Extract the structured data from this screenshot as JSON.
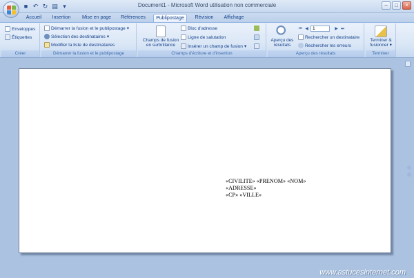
{
  "window": {
    "title": "Document1 - Microsoft Word utilisation non commerciale",
    "controls": {
      "minimize": "–",
      "maximize": "□",
      "close": "×"
    }
  },
  "quick_access": {
    "icons": [
      "save-icon",
      "undo-icon",
      "redo-icon",
      "print-preview-icon",
      "customize-icon"
    ],
    "glyphs": {
      "save": "■",
      "undo": "↶",
      "redo": "↻",
      "print": "▤",
      "more": "▾"
    }
  },
  "tabs": [
    {
      "label": "Accueil",
      "active": false
    },
    {
      "label": "Insertion",
      "active": false
    },
    {
      "label": "Mise en page",
      "active": false
    },
    {
      "label": "Références",
      "active": false
    },
    {
      "label": "Publipostage",
      "active": true
    },
    {
      "label": "Révision",
      "active": false
    },
    {
      "label": "Affichage",
      "active": false
    }
  ],
  "ribbon": {
    "creer": {
      "label": "Créer",
      "envelopes": "Enveloppes",
      "labels": "Étiquettes"
    },
    "demarrer": {
      "label": "Démarrer la fusion et le publipostage",
      "start_merge": "Démarrer la fusion et le publipostage",
      "select_recipients": "Sélection des destinataires",
      "edit_list": "Modifier la liste de destinataires"
    },
    "champs": {
      "label": "Champs d'écriture et d'insertion",
      "highlight_line1": "Champs de fusion",
      "highlight_line2": "en surbrillance",
      "address_block": "Bloc d'adresse",
      "greeting_line": "Ligne de salutation",
      "insert_field": "Insérer un champ de fusion"
    },
    "apercu": {
      "label": "Aperçu des résultats",
      "preview_line1": "Aperçu des",
      "preview_line2": "résultats",
      "record_number": "1",
      "find_recipient": "Rechercher un destinataire",
      "check_errors": "Rechercher les erreurs"
    },
    "terminer": {
      "label": "Terminer",
      "finish_line1": "Terminer &",
      "finish_line2": "fusionner"
    }
  },
  "document": {
    "lines": [
      "«CIVILITE» «PRENOM» «NOM»",
      "«ADRESSE»",
      "«CP» «VILLE»"
    ]
  },
  "watermark": "www.astucesinternet.com",
  "colors": {
    "accent": "#15428b",
    "workspace": "#abc3e0",
    "ribbon_bg": "#dbe7f6"
  }
}
